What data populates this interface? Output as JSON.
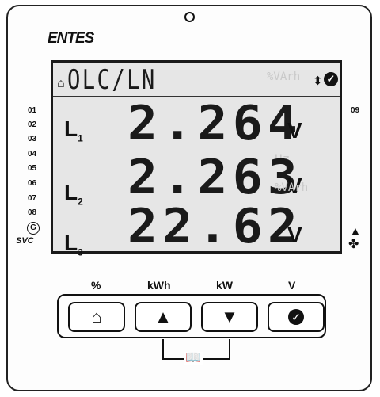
{
  "brand": "ENTES",
  "display": {
    "header": "OLC/LN",
    "units_ghost": "%VArh",
    "rows": [
      {
        "label": "L",
        "sub": "1",
        "value": "2.264",
        "unit": "V"
      },
      {
        "label": "L",
        "sub": "2",
        "value": "2.263",
        "unit": "V"
      },
      {
        "label": "L",
        "sub": "3",
        "value": "22.62",
        "unit": "V"
      }
    ],
    "ghost_hz": "Hz",
    "ghost_varh": "%VArh"
  },
  "side_numbers": [
    "01",
    "02",
    "03",
    "04",
    "05",
    "06",
    "07",
    "08"
  ],
  "right_number": "09",
  "svc_label": "SVC",
  "g_label": "G",
  "buttons": {
    "home_label": "%",
    "up_label": "kWh",
    "down_label": "kW",
    "ok_label": "V"
  },
  "colors": {
    "lcd_bg": "#e6e6e6",
    "segment": "#1a1a1a"
  }
}
